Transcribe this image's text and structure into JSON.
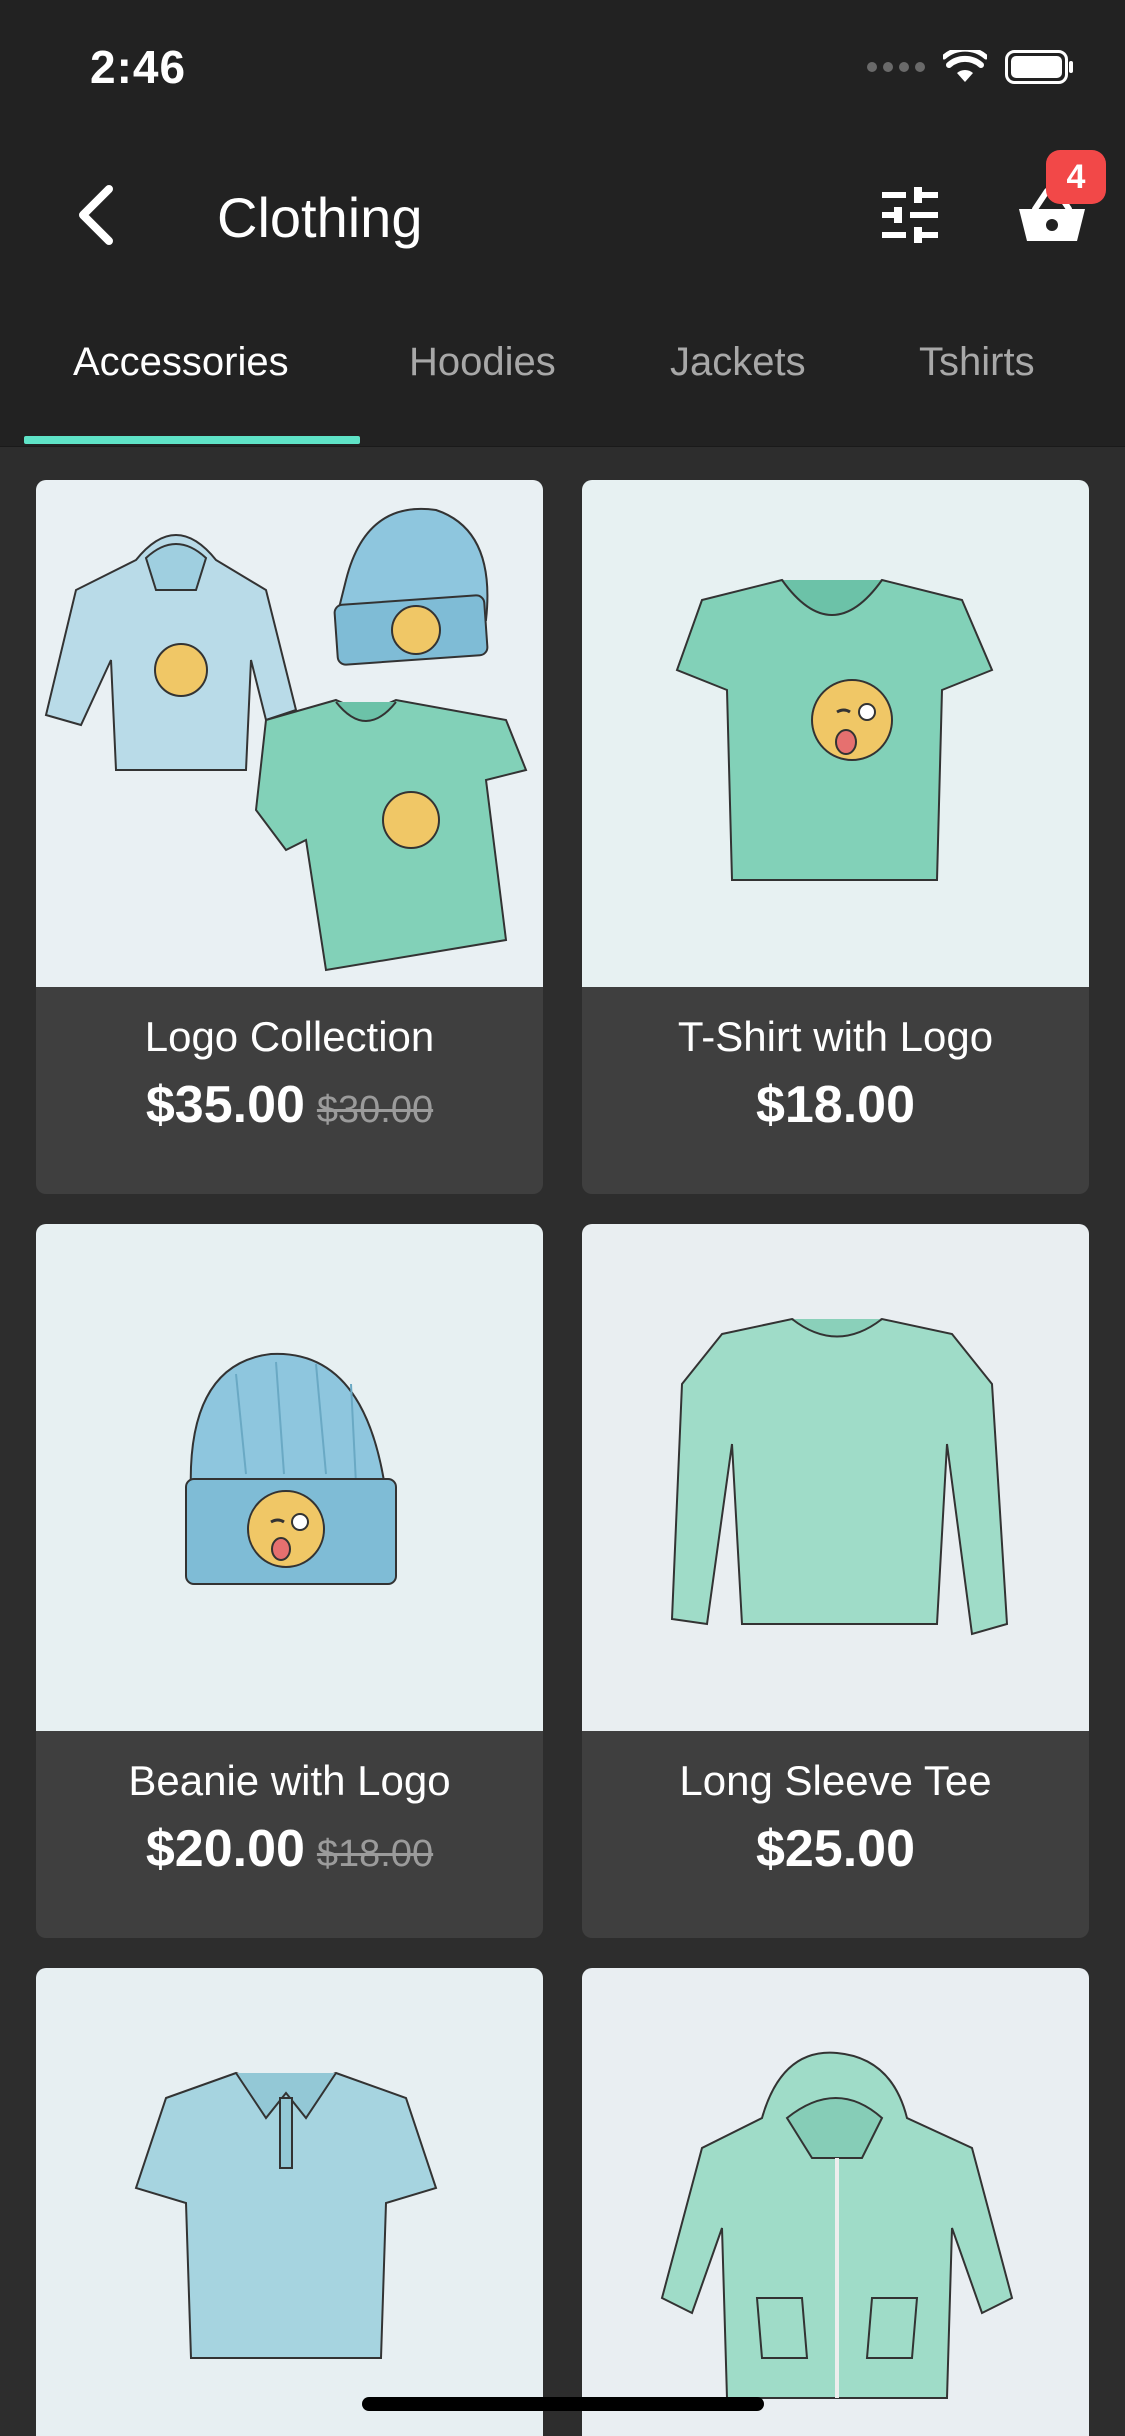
{
  "status_bar": {
    "time": "2:46"
  },
  "header": {
    "title": "Clothing",
    "cart_count": "4"
  },
  "tabs": [
    {
      "label": "Accessories",
      "active": true
    },
    {
      "label": "Hoodies",
      "active": false
    },
    {
      "label": "Jackets",
      "active": false
    },
    {
      "label": "Tshirts",
      "active": false
    }
  ],
  "products": [
    {
      "name": "Logo Collection",
      "price": "$35.00",
      "old_price": "$30.00",
      "image": "collection-illustration"
    },
    {
      "name": "T-Shirt with Logo",
      "price": "$18.00",
      "old_price": "",
      "image": "tshirt-illustration"
    },
    {
      "name": "Beanie with Logo",
      "price": "$20.00",
      "old_price": "$18.00",
      "image": "beanie-illustration"
    },
    {
      "name": "Long Sleeve Tee",
      "price": "$25.00",
      "old_price": "",
      "image": "long-sleeve-illustration"
    },
    {
      "name": "",
      "price": "",
      "old_price": "",
      "image": "polo-illustration"
    },
    {
      "name": "",
      "price": "",
      "old_price": "",
      "image": "hoodie-zip-illustration"
    }
  ],
  "colors": {
    "accent": "#5fe3c7",
    "badge": "#f24848",
    "header_bg": "#222222",
    "card_bg": "#3f3f3f"
  }
}
